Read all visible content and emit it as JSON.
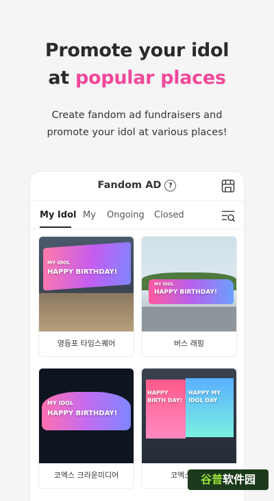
{
  "hero": {
    "title_line1": "Promote your idol",
    "title_line2_prefix": "at ",
    "title_line2_highlight": "popular places",
    "subtitle_line1": "Create fandom ad fundraisers and",
    "subtitle_line2": "promote your idol at various places!"
  },
  "card": {
    "title": "Fandom AD",
    "help_glyph": "?",
    "tabs": [
      "My Idol",
      "My",
      "Ongoing",
      "Closed"
    ],
    "active_tab": "My Idol"
  },
  "items": [
    {
      "caption": "영등포 타임스퀘어",
      "overlay_small": "MY IDOL",
      "overlay_big": "HAPPY BIRTHDAY!"
    },
    {
      "caption": "버스 래핑",
      "overlay_small": "MY IDOL",
      "overlay_big": "HAPPY BIRTHDAY!"
    },
    {
      "caption": "코엑스 크라운미디어",
      "overlay_small": "MY IDOL",
      "overlay_big": "HAPPY BIRTHDAY!"
    },
    {
      "caption": "코엑스 케이",
      "overlay_small": "HAPPY BIRTH DAY!",
      "overlay_big": "HAPPY MY IDOL DAY"
    }
  ],
  "watermark": {
    "text_part1": "谷普",
    "text_part2": "软件园"
  },
  "colors": {
    "accent": "#f0489a",
    "background": "#f5f5f6"
  }
}
